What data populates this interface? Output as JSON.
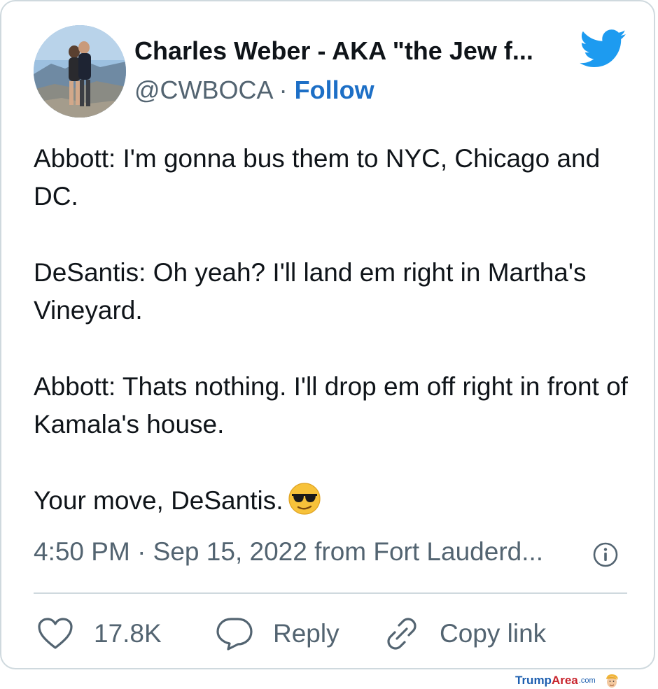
{
  "author": {
    "display_name": "Charles Weber - AKA \"the Jew f...",
    "handle": "@CWBOCA",
    "separator": "·",
    "follow_label": "Follow"
  },
  "tweet": {
    "paragraphs": [
      "Abbott: I'm gonna bus them to NYC, Chicago and DC.",
      "DeSantis: Oh yeah? I'll land em right in Martha's Vineyard.",
      "Abbott: Thats nothing. I'll drop em off right in front of Kamala's house.",
      "Your move, DeSantis."
    ],
    "emoji": "smiling-face-with-sunglasses",
    "timestamp": "4:50 PM · Sep 15, 2022 from Fort Lauderd..."
  },
  "actions": {
    "like_count": "17.8K",
    "reply_label": "Reply",
    "copy_link_label": "Copy link"
  },
  "footer": {
    "brand_part1": "Trump",
    "brand_part2": "Area",
    "brand_part3": ".com"
  },
  "colors": {
    "twitter_blue": "#1d9bf0",
    "follow_blue": "#1d6fc6",
    "text_primary": "#0f1419",
    "text_secondary": "#536471",
    "border": "#cfd9de"
  }
}
